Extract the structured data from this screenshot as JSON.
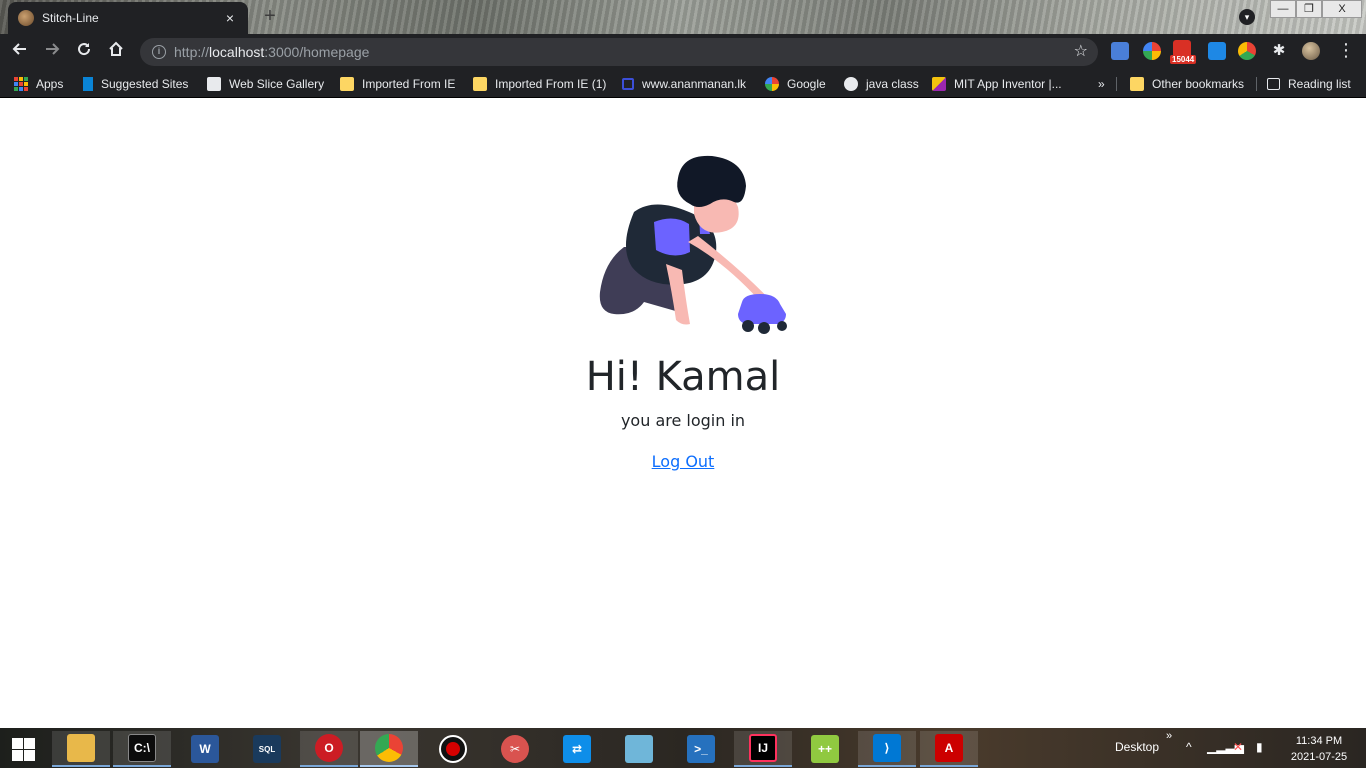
{
  "browser": {
    "tab_title": "Stitch-Line",
    "tab_close": "×",
    "new_tab": "+",
    "url_prefix": "http://",
    "url_host": "localhost",
    "url_path": ":3000/homepage",
    "ext_badge": "15044"
  },
  "window_controls": {
    "minimize": "—",
    "maximize": "❐",
    "close": "X"
  },
  "bookmarks": [
    {
      "label": "Apps",
      "icon": "apps-grid-icon"
    },
    {
      "label": "Suggested Sites",
      "icon": "bing-icon"
    },
    {
      "label": "Web Slice Gallery",
      "icon": "web-slice-icon"
    },
    {
      "label": "Imported From IE",
      "icon": "folder-icon"
    },
    {
      "label": "Imported From IE (1)",
      "icon": "folder-icon"
    },
    {
      "label": "www.ananmanan.lk",
      "icon": "site-icon"
    },
    {
      "label": "Google",
      "icon": "google-icon"
    },
    {
      "label": "java class",
      "icon": "globe-icon"
    },
    {
      "label": "MIT App Inventor |...",
      "icon": "app-inventor-icon"
    },
    {
      "label": "Other bookmarks",
      "icon": "folder-icon"
    },
    {
      "label": "Reading list",
      "icon": "reading-list-icon"
    }
  ],
  "bookmarks_overflow": "»",
  "page": {
    "greeting": "Hi! Kamal",
    "subtitle": "you are login in",
    "logout": "Log Out"
  },
  "taskbar": {
    "desktop": "Desktop",
    "time": "11:34 PM",
    "date": "2021-07-25",
    "overflow": "»",
    "apps": [
      {
        "name": "file-explorer",
        "color": "#e8b84a",
        "open": true
      },
      {
        "name": "command-prompt",
        "color": "#0c0c0c",
        "open": true
      },
      {
        "name": "word",
        "color": "#2b579a",
        "open": false
      },
      {
        "name": "mysql",
        "color": "#1a3a5c",
        "open": false
      },
      {
        "name": "opera",
        "color": "#cc1c24",
        "open": true
      },
      {
        "name": "chrome",
        "color": "#4285f4",
        "open": true
      },
      {
        "name": "recorder",
        "color": "#d50000",
        "open": false
      },
      {
        "name": "snipping-tool",
        "color": "#d9534f",
        "open": false
      },
      {
        "name": "teamviewer",
        "color": "#0e8ee9",
        "open": false
      },
      {
        "name": "notepad-blue",
        "color": "#6fb6d9",
        "open": false
      },
      {
        "name": "powershell",
        "color": "#2671be",
        "open": false
      },
      {
        "name": "intellij",
        "color": "#000000",
        "open": true
      },
      {
        "name": "notepad-plus",
        "color": "#90c940",
        "open": false
      },
      {
        "name": "vscode",
        "color": "#0078d4",
        "open": true
      },
      {
        "name": "acrobat",
        "color": "#c00",
        "open": true
      }
    ]
  },
  "colors": {
    "link": "#0d6efd",
    "text": "#212529",
    "illustration_purple": "#6c63ff",
    "illustration_dark": "#1f2937"
  }
}
